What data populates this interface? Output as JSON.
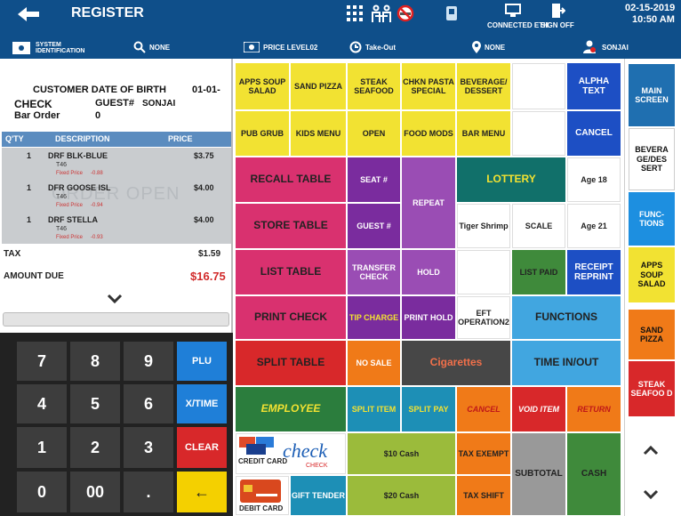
{
  "header": {
    "title": "REGISTER",
    "date": "02-15-2019",
    "time": "10:50 AM",
    "connected": "CONNECTED ETH",
    "sign_off": "SIGN OFF"
  },
  "subbar": {
    "system_id": "SYSTEM IDENTIFICATION",
    "search_value": "NONE",
    "price_level": "PRICE LEVEL02",
    "order_type": "Take-Out",
    "location": "NONE",
    "user": "SONJAI"
  },
  "receipt": {
    "title_left": "CUSTOMER DATE OF BIRTH",
    "title_right": "01-01-",
    "check_label": "CHECK",
    "guest_label": "GUEST#",
    "guest_name": "SONJAI",
    "order_label": "Bar Order",
    "order_value": "0",
    "columns": [
      "Q'TY",
      "DESCRIPTION",
      "PRICE"
    ],
    "watermark": "ORDER OPEN",
    "items": [
      {
        "qty": "1",
        "desc": "DRF BLK-BLUE",
        "price": "$3.75",
        "sub": "T46",
        "note": "Fixed Price",
        "note_val": "-0.88"
      },
      {
        "qty": "1",
        "desc": "DFR GOOSE ISL",
        "price": "$4.00",
        "sub": "T46",
        "note": "Fixed Price",
        "note_val": "-0.94"
      },
      {
        "qty": "1",
        "desc": "DRF STELLA",
        "price": "$4.00",
        "sub": "T46",
        "note": "Fixed Price",
        "note_val": "-0.93"
      }
    ],
    "tax_label": "TAX",
    "tax_value": "$1.59",
    "amount_label": "AMOUNT DUE",
    "amount_value": "$16.75"
  },
  "keypad": {
    "keys": [
      "7",
      "8",
      "9",
      "4",
      "5",
      "6",
      "1",
      "2",
      "3",
      "0",
      "00",
      "."
    ],
    "plu": "PLU",
    "xtime": "X/TIME",
    "clear": "CLEAR",
    "enter": "←"
  },
  "menu": {
    "apps_soup_salad": "APPS SOUP SALAD",
    "sand_pizza": "SAND PIZZA",
    "steak_seafood": "STEAK SEAFOOD",
    "chkn_pasta": "CHKN PASTA SPECIAL",
    "beverage_dessert": "BEVERAGE/ DESSERT",
    "alpha_text": "ALPHA TEXT",
    "pub_grub": "PUB GRUB",
    "kids_menu": "KIDS MENU",
    "open": "OPEN",
    "food_mods": "FOOD MODS",
    "bar_menu": "BAR MENU",
    "cancel": "CANCEL",
    "recall_table": "RECALL TABLE",
    "seat": "SEAT #",
    "repeat": "REPEAT",
    "lottery": "LOTTERY",
    "age18": "Age 18",
    "store_table": "STORE TABLE",
    "guest": "GUEST #",
    "tiger_shrimp": "Tiger Shrimp",
    "scale": "SCALE",
    "age21": "Age 21",
    "list_table": "LIST TABLE",
    "transfer_check": "TRANSFER CHECK",
    "hold": "HOLD",
    "list_paid": "LIST PAID",
    "receipt_reprint": "RECEIPT REPRINT",
    "print_check": "PRINT CHECK",
    "tip_charge": "TIP CHARGE",
    "print_hold": "PRINT HOLD",
    "eft_operation": "EFT OPERATION2",
    "functions": "FUNCTIONS",
    "split_table": "SPLIT TABLE",
    "no_sale": "NO SALE",
    "cigarettes": "Cigarettes",
    "time_in_out": "TIME IN/OUT",
    "employee": "EMPLOYEE",
    "split_item": "SPLIT ITEM",
    "split_pay": "SPLIT PAY",
    "cancel2": "CANCEL",
    "void_item": "VOID ITEM",
    "return": "RETURN",
    "credit_card": "CREDIT CARD",
    "check": "check",
    "check_small": "CHECK",
    "gift_tender": "GIFT TENDER",
    "debit_card": "DEBIT CARD",
    "cash10": "$10 Cash",
    "cash20": "$20 Cash",
    "tax_exempt": "TAX EXEMPT",
    "tax_shift": "TAX SHIFT",
    "subtotal": "SUBTOTAL",
    "cash": "CASH"
  },
  "sidebar": {
    "main_screen": "MAIN SCREEN",
    "beverage": "BEVERA GE/DES SERT",
    "functions": "FUNC- TIONS",
    "apps": "APPS SOUP SALAD",
    "sand_pizza": "SAND PIZZA",
    "steak": "STEAK SEAFOO D"
  },
  "colors": {
    "header": "#0f4f8a",
    "yellow": "#f2e232",
    "blue": "#1d4fc4",
    "pink": "#d9316f",
    "purple": "#7a2c9e",
    "teal": "#11706a",
    "green": "#3f8a3b",
    "sky": "#41a6e0",
    "red": "#d8282a",
    "lime": "#9bbb3b",
    "orange": "#f07a18"
  }
}
